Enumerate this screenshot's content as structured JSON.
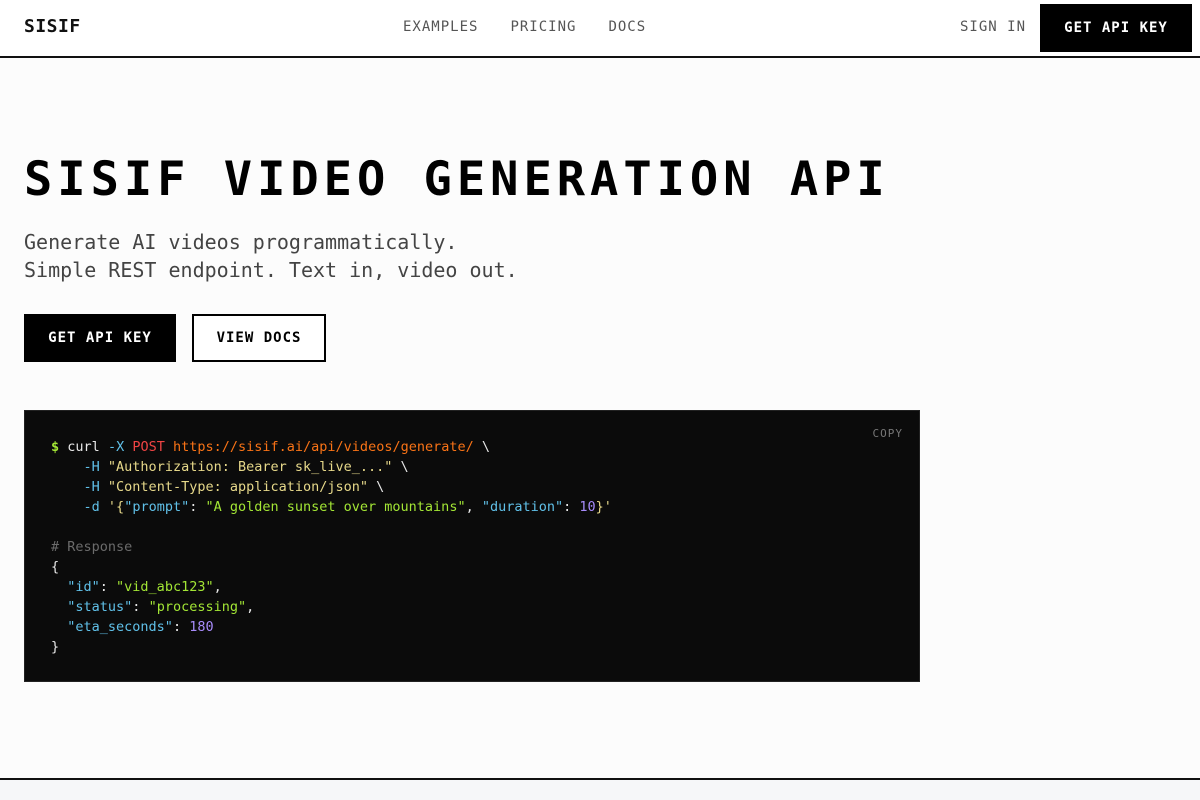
{
  "header": {
    "logo": "SISIF",
    "nav": [
      "EXAMPLES",
      "PRICING",
      "DOCS"
    ],
    "sign_in": "SIGN IN",
    "cta": "GET API KEY"
  },
  "hero": {
    "title": "SISIF VIDEO GENERATION API",
    "subtitle_line1": "Generate AI videos programmatically.",
    "subtitle_line2": "Simple REST endpoint. Text in, video out.",
    "primary_button": "GET API KEY",
    "secondary_button": "VIEW DOCS"
  },
  "code": {
    "copy_label": "COPY",
    "prompt": "$",
    "cmd": "curl",
    "flag_x": "-X",
    "method": "POST",
    "url": "https://sisif.ai/api/videos/generate/",
    "cont": "\\",
    "flag_h": "-H",
    "auth_header": "\"Authorization: Bearer sk_live_...\"",
    "ct_header": "\"Content-Type: application/json\"",
    "flag_d": "-d",
    "body_open": "'{",
    "key_prompt": "\"prompt\"",
    "val_prompt": "\"A golden sunset over mountains\"",
    "key_duration": "\"duration\"",
    "val_duration": "10",
    "body_close": "}'",
    "comment": "# Response",
    "brace_open": "{",
    "key_id": "\"id\"",
    "val_id": "\"vid_abc123\"",
    "key_status": "\"status\"",
    "val_status": "\"processing\"",
    "key_eta": "\"eta_seconds\"",
    "val_eta": "180",
    "brace_close": "}"
  },
  "colors": {
    "prompt": "#a3e635",
    "flag": "#60c0e8",
    "method": "#ef4444",
    "url": "#f97316",
    "string": "#e6d88a",
    "number": "#a78bfa",
    "comment": "#6b6b6b"
  }
}
